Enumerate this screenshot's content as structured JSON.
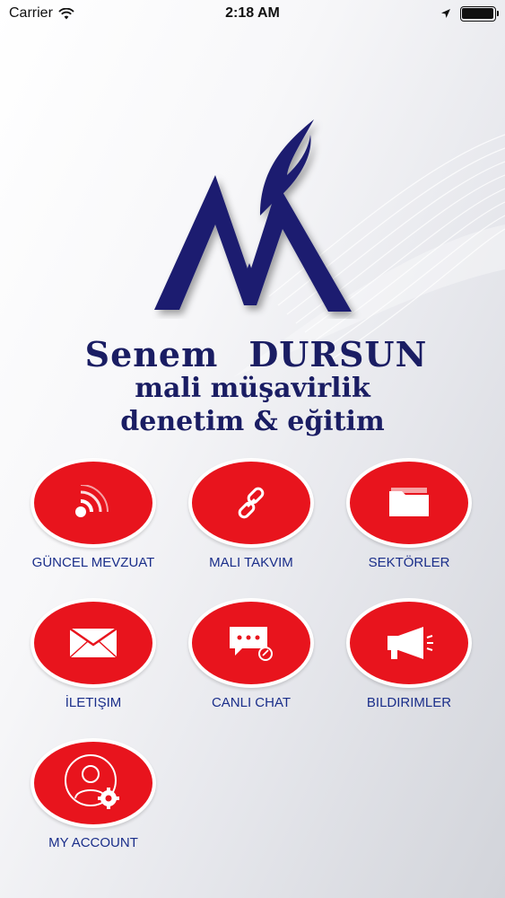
{
  "status_bar": {
    "carrier": "Carrier",
    "time": "2:18 AM",
    "battery_level": 1.0
  },
  "brand": {
    "first_name": "Senem",
    "last_name": "DURSUN",
    "line2": "mali müşavirlik",
    "line3": "denetim & eğitim"
  },
  "colors": {
    "tile_red": "#e8141d",
    "label_blue": "#1a2e8a",
    "brand_navy": "#1a1d63"
  },
  "tiles": [
    {
      "label": "GÜNCEL MEVZUAT",
      "icon": "rss-icon"
    },
    {
      "label": "MALI TAKVIM",
      "icon": "link-icon"
    },
    {
      "label": "SEKTÖRLER",
      "icon": "folder-icon"
    },
    {
      "label": "İLETIŞIM",
      "icon": "envelope-icon"
    },
    {
      "label": "CANLI CHAT",
      "icon": "chat-icon"
    },
    {
      "label": "BILDIRIMLER",
      "icon": "megaphone-icon"
    },
    {
      "label": "MY ACCOUNT",
      "icon": "user-settings-icon"
    }
  ]
}
